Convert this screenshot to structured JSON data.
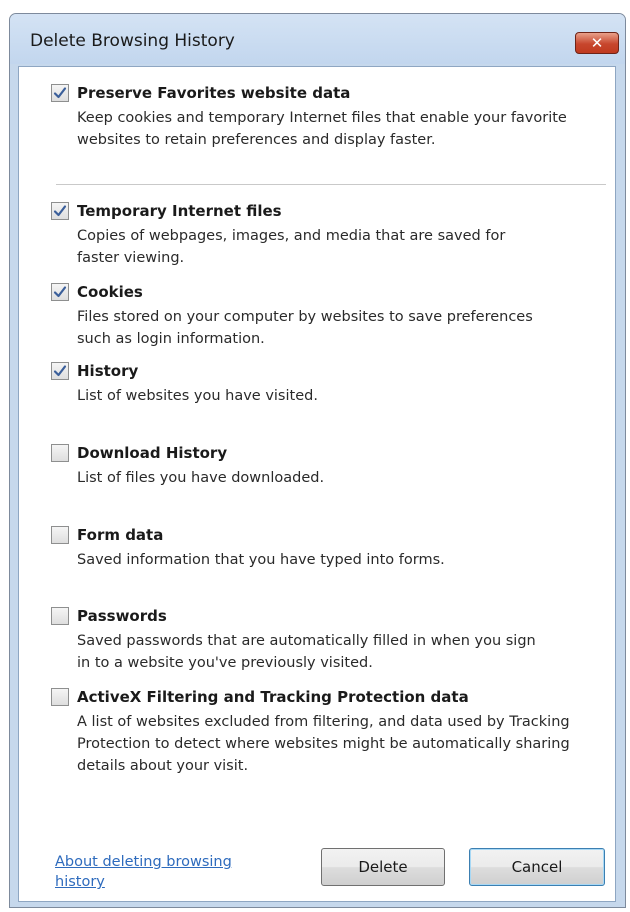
{
  "window": {
    "title": "Delete Browsing History",
    "close_glyph": "✕"
  },
  "options": [
    {
      "label": "Preserve Favorites website data",
      "checked": true,
      "description": "Keep cookies and temporary Internet files that enable your favorite\nwebsites to retain preferences and display faster."
    },
    {
      "label": "Temporary Internet files",
      "checked": true,
      "description": "Copies of webpages, images, and media that are saved for\nfaster viewing."
    },
    {
      "label": "Cookies",
      "checked": true,
      "description": "Files stored on your computer by websites to save preferences\nsuch as login information."
    },
    {
      "label": "History",
      "checked": true,
      "description": "List of websites you have visited."
    },
    {
      "label": "Download History",
      "checked": false,
      "description": "List of files you have downloaded."
    },
    {
      "label": "Form data",
      "checked": false,
      "description": "Saved information that you have typed into forms."
    },
    {
      "label": "Passwords",
      "checked": false,
      "description": "Saved passwords that are automatically filled in when you sign\nin to a website you've previously visited."
    },
    {
      "label": "ActiveX Filtering and Tracking Protection data",
      "checked": false,
      "description": "A list of websites excluded from filtering, and data used by Tracking\nProtection to detect where websites might be automatically sharing\ndetails about your visit."
    }
  ],
  "footer": {
    "link_text": "About deleting browsing history",
    "delete_label": "Delete",
    "cancel_label": "Cancel"
  },
  "colors": {
    "link": "#2e6bbd",
    "checkmark": "#3b5f9a",
    "close_button": "#c7462d"
  }
}
